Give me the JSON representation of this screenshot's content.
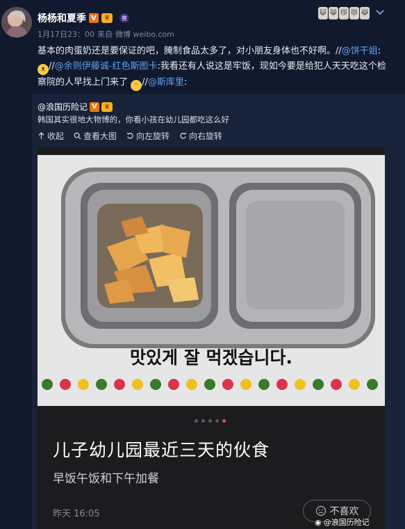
{
  "post": {
    "username": "杨杨和夏季",
    "badge_v": "V",
    "badge_crown": "♛",
    "badge_extra": "夜",
    "timestamp": "1月17日23：00",
    "source_prefix": "来自",
    "source": "微博 weibo.com",
    "body": {
      "t1": "基本的肉蛋奶还是要保证的吧，腌制食品太多了，对小朋友身体也不好啊。//",
      "m1": "@饼干姐",
      "t2": ":",
      "t3": "//",
      "m2": "@余则伊藤诚-红色斯图卡",
      "t4": ":我看还有人说这是牢饭，现如今要是给犯人天天吃这个检察院的人早找上门来了",
      "t5": "//",
      "m3": "@斯库里",
      "t6": ":"
    }
  },
  "repost": {
    "username": "@浪国历险记",
    "text": "韩国其实很地大物博的，你看小孩在幼儿园都吃这么好",
    "toolbar": {
      "collapse": "收起",
      "view_large": "查看大图",
      "rotate_left": "向左旋转",
      "rotate_right": "向右旋转"
    }
  },
  "card": {
    "photo_caption": "맛있게 잘 먹겠습니다.",
    "page_indicator": {
      "total": 5,
      "active": 5
    },
    "title": "儿子幼儿园最近三天的伙食",
    "subtitle": "早饭午饭和下午加餐",
    "time": "昨天 16:05",
    "dislike_label": "不喜欢"
  },
  "watermark": "@浪国历险记",
  "colors": {
    "background": "#10192e",
    "repost_bg": "#182238",
    "link": "#5fa2f0",
    "vip_badge": "#e8731a",
    "active_dot": "#ff3b5c"
  }
}
